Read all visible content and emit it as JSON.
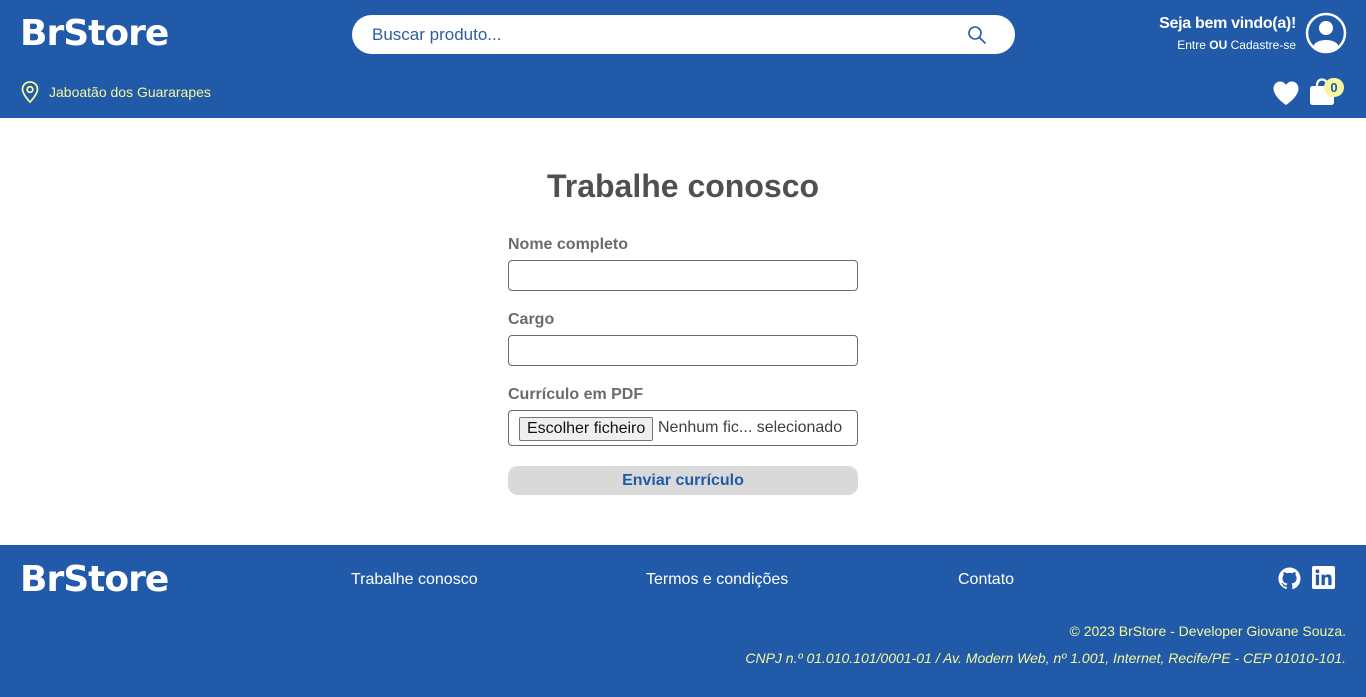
{
  "header": {
    "logo": "BrStore",
    "search_placeholder": "Buscar produto...",
    "welcome_title": "Seja bem vindo(a)!",
    "login_link": "Entre",
    "or_text": "OU",
    "signup_link": "Cadastre-se",
    "location": "Jaboatão dos Guararapes",
    "cart_count": "0"
  },
  "main": {
    "title": "Trabalhe conosco",
    "form": {
      "name_label": "Nome completo",
      "role_label": "Cargo",
      "cv_label": "Currículo em PDF",
      "file_button": "Escolher ficheiro",
      "file_status": "Nenhum fic... selecionado",
      "submit_label": "Enviar currículo"
    }
  },
  "footer": {
    "logo": "BrStore",
    "links": [
      "Trabalhe conosco",
      "Termos e condições",
      "Contato"
    ],
    "copyright": "© 2023 BrStore - Developer Giovane Souza.",
    "cnpj": "CNPJ n.º 01.010.101/0001-01 / Av. Modern Web, nº 1.001, Internet, Recife/PE - CEP 01010-101."
  },
  "colors": {
    "brand": "#215aa8",
    "accent": "#f4f79e",
    "button_bg": "#d9d9d9"
  },
  "icons": [
    "search-icon",
    "user-avatar-icon",
    "location-pin-icon",
    "heart-icon",
    "shopping-bag-icon",
    "github-icon",
    "linkedin-icon"
  ]
}
